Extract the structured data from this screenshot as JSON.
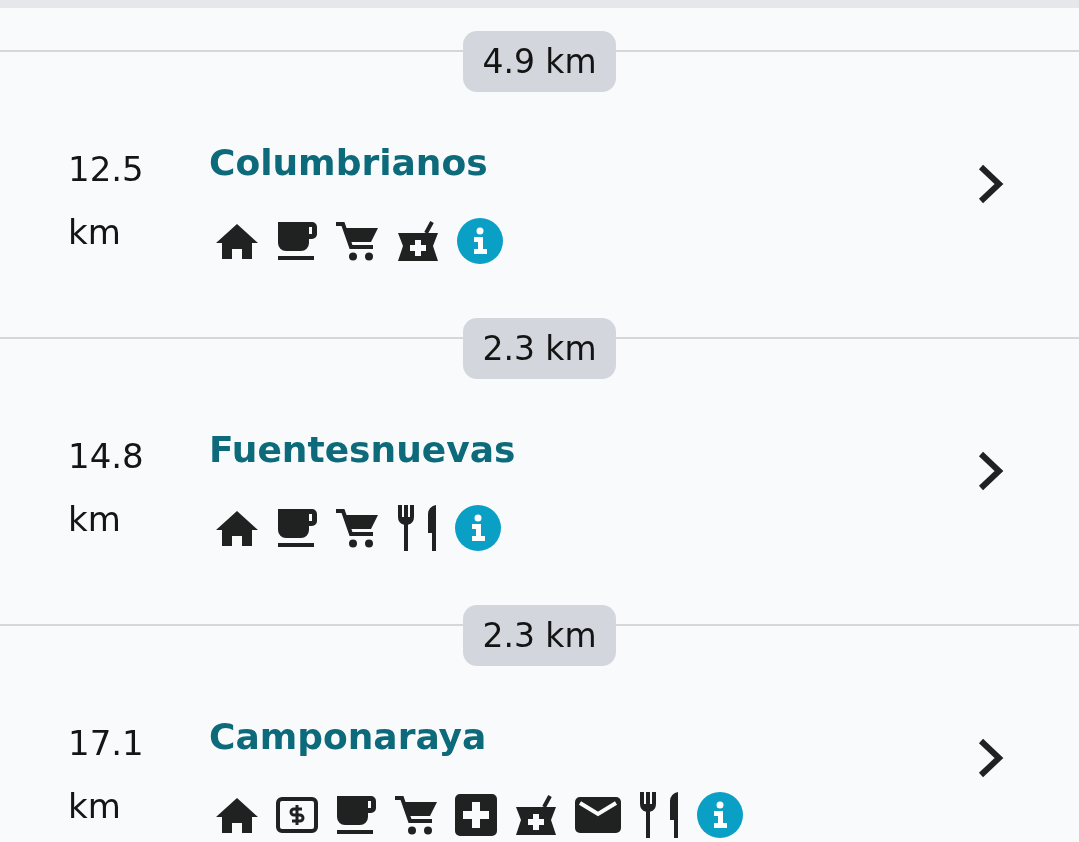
{
  "stages": [
    {
      "segment_distance": "4.9 km",
      "town": {
        "distance": "12.5 km",
        "name": "Columbrianos",
        "amenities": [
          {
            "kind": "lodging"
          },
          {
            "kind": "cafe"
          },
          {
            "kind": "shop"
          },
          {
            "kind": "pharmacy"
          },
          {
            "kind": "info"
          }
        ]
      }
    },
    {
      "segment_distance": "2.3 km",
      "town": {
        "distance": "14.8 km",
        "name": "Fuentesnuevas",
        "amenities": [
          {
            "kind": "lodging"
          },
          {
            "kind": "cafe"
          },
          {
            "kind": "shop"
          },
          {
            "kind": "restaurant"
          },
          {
            "kind": "info"
          }
        ]
      }
    },
    {
      "segment_distance": "2.3 km",
      "town": {
        "distance": "17.1 km",
        "name": "Camponaraya",
        "amenities": [
          {
            "kind": "lodging"
          },
          {
            "kind": "atm"
          },
          {
            "kind": "cafe"
          },
          {
            "kind": "shop"
          },
          {
            "kind": "medical"
          },
          {
            "kind": "pharmacy"
          },
          {
            "kind": "post"
          },
          {
            "kind": "restaurant"
          },
          {
            "kind": "info"
          }
        ]
      }
    }
  ]
}
